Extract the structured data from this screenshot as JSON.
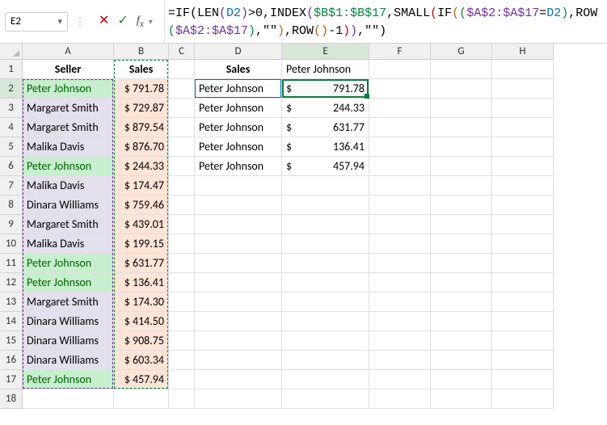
{
  "nameBox": "E2",
  "formula_parts": [
    {
      "cls": "t-black",
      "t": "="
    },
    {
      "cls": "t-black",
      "t": "IF"
    },
    {
      "cls": "t-black",
      "t": "("
    },
    {
      "cls": "t-black",
      "t": "LEN"
    },
    {
      "cls": "t-purple",
      "t": "("
    },
    {
      "cls": "t-blue",
      "t": "D2"
    },
    {
      "cls": "t-purple",
      "t": ")"
    },
    {
      "cls": "t-black",
      "t": ">0,"
    },
    {
      "cls": "t-black",
      "t": "INDEX"
    },
    {
      "cls": "t-purple",
      "t": "("
    },
    {
      "cls": "t-green",
      "t": "$B$1:$B$17"
    },
    {
      "cls": "t-black",
      "t": ","
    },
    {
      "cls": "t-black",
      "t": "SMALL"
    },
    {
      "cls": "t-red",
      "t": "("
    },
    {
      "cls": "t-black",
      "t": "IF"
    },
    {
      "cls": "t-orange",
      "t": "("
    },
    {
      "cls": "t-green",
      "t": "("
    },
    {
      "cls": "t-purple",
      "t": "$A$2:$A$17"
    },
    {
      "cls": "t-black",
      "t": "="
    },
    {
      "cls": "t-blue",
      "t": "D2"
    },
    {
      "cls": "t-green",
      "t": ")"
    },
    {
      "cls": "t-black",
      "t": ","
    },
    {
      "cls": "t-black",
      "t": "ROW"
    },
    {
      "cls": "t-green",
      "t": "("
    },
    {
      "cls": "t-purple",
      "t": "$A$2:$A$17"
    },
    {
      "cls": "t-green",
      "t": ")"
    },
    {
      "cls": "t-black",
      "t": ",\"\""
    },
    {
      "cls": "t-orange",
      "t": ")"
    },
    {
      "cls": "t-black",
      "t": ","
    },
    {
      "cls": "t-black",
      "t": "ROW"
    },
    {
      "cls": "t-orange",
      "t": "("
    },
    {
      "cls": "t-orange",
      "t": ")"
    },
    {
      "cls": "t-black",
      "t": "-1"
    },
    {
      "cls": "t-red",
      "t": ")"
    },
    {
      "cls": "t-purple",
      "t": ")"
    },
    {
      "cls": "t-black",
      "t": ",\"\""
    },
    {
      "cls": "t-black",
      "t": ")"
    }
  ],
  "columns": [
    "A",
    "B",
    "C",
    "D",
    "E",
    "F",
    "G",
    "H"
  ],
  "headers": {
    "A": "Seller",
    "B": "Sales",
    "D": "Sales",
    "E": "Peter Johnson"
  },
  "tableAB": [
    {
      "seller": "Peter Johnson",
      "sales": "$ 791.78",
      "pj": true
    },
    {
      "seller": "Margaret Smith",
      "sales": "$ 729.87",
      "pj": false
    },
    {
      "seller": "Margaret Smith",
      "sales": "$ 879.54",
      "pj": false
    },
    {
      "seller": "Malika Davis",
      "sales": "$ 876.70",
      "pj": false
    },
    {
      "seller": "Peter Johnson",
      "sales": "$ 244.33",
      "pj": true
    },
    {
      "seller": "Malika Davis",
      "sales": "$ 174.47",
      "pj": false
    },
    {
      "seller": "Dinara Williams",
      "sales": "$ 759.46",
      "pj": false
    },
    {
      "seller": "Margaret Smith",
      "sales": "$ 439.01",
      "pj": false
    },
    {
      "seller": "Malika Davis",
      "sales": "$ 199.15",
      "pj": false
    },
    {
      "seller": "Peter Johnson",
      "sales": "$ 631.77",
      "pj": true
    },
    {
      "seller": "Peter Johnson",
      "sales": "$ 136.41",
      "pj": true
    },
    {
      "seller": "Margaret Smith",
      "sales": "$ 174.30",
      "pj": false
    },
    {
      "seller": "Dinara Williams",
      "sales": "$ 414.50",
      "pj": false
    },
    {
      "seller": "Dinara Williams",
      "sales": "$ 908.75",
      "pj": false
    },
    {
      "seller": "Dinara Williams",
      "sales": "$ 603.34",
      "pj": false
    },
    {
      "seller": "Peter Johnson",
      "sales": "$ 457.94",
      "pj": true
    }
  ],
  "tableDE": [
    {
      "d": "Peter Johnson",
      "e_sym": "$",
      "e_val": "791.78"
    },
    {
      "d": "Peter Johnson",
      "e_sym": "$",
      "e_val": "244.33"
    },
    {
      "d": "Peter Johnson",
      "e_sym": "$",
      "e_val": "631.77"
    },
    {
      "d": "Peter Johnson",
      "e_sym": "$",
      "e_val": "136.41"
    },
    {
      "d": "Peter Johnson",
      "e_sym": "$",
      "e_val": "457.94"
    }
  ],
  "rowCount": 18,
  "activeCell": {
    "col": "E",
    "row": 2
  }
}
